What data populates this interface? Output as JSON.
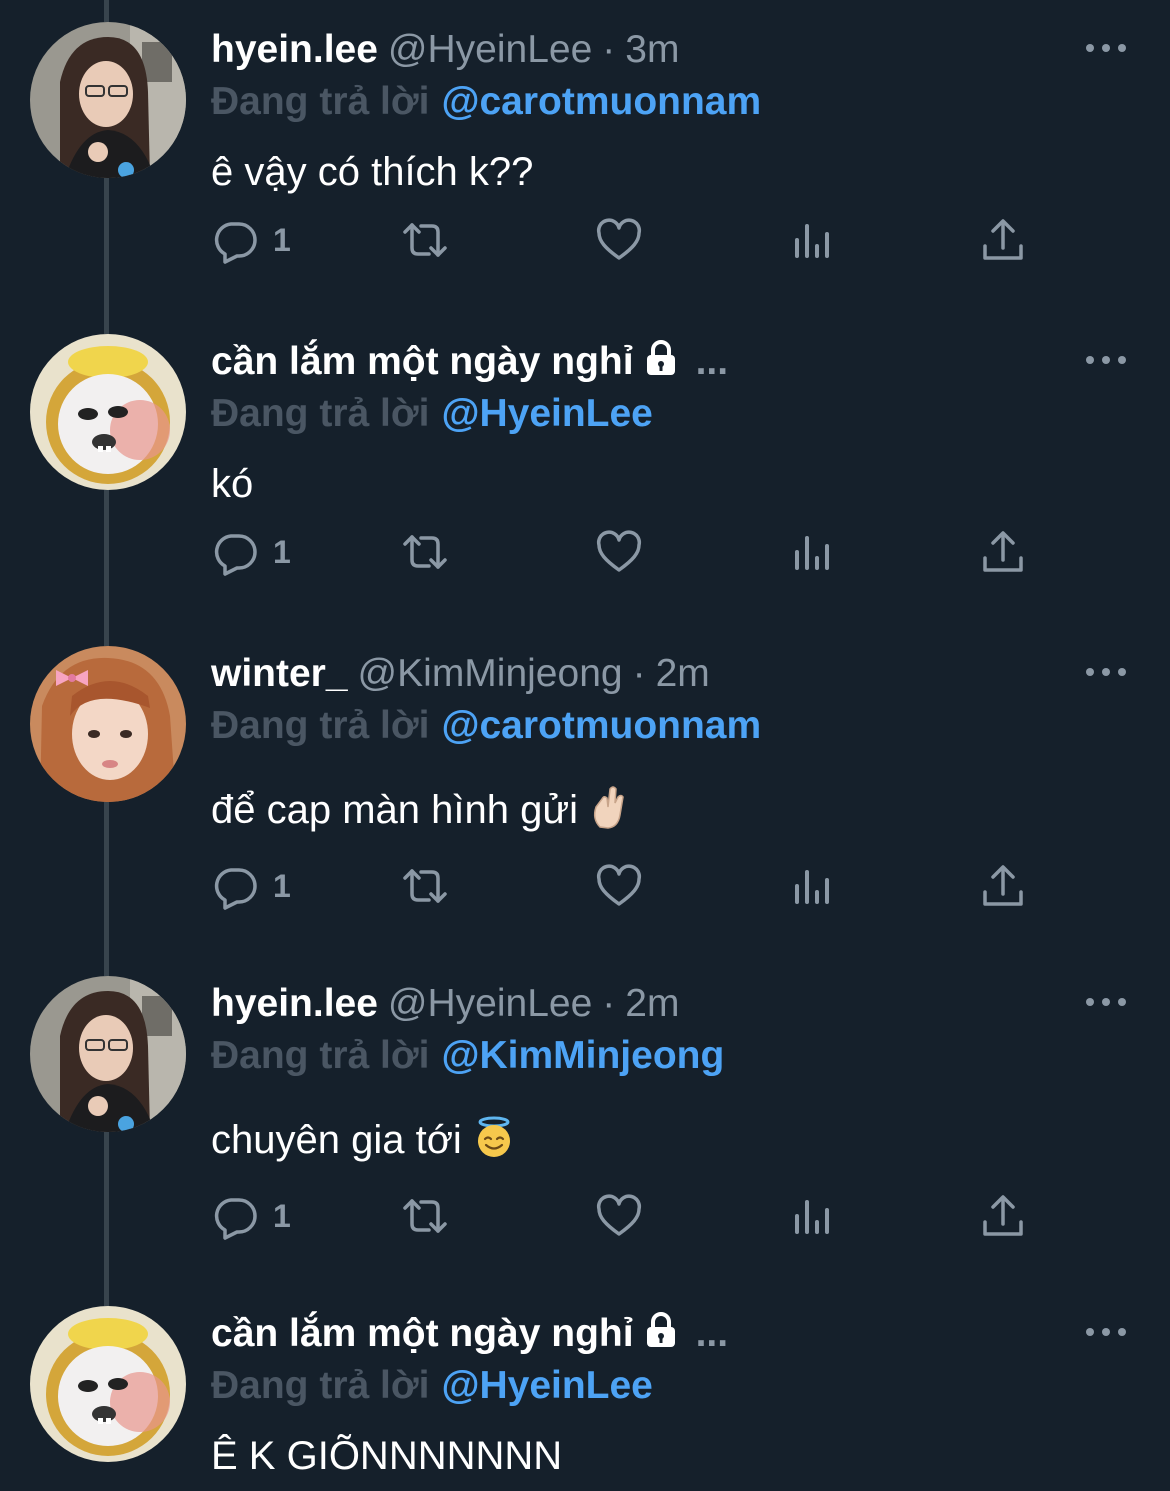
{
  "tweets": [
    {
      "name": "hyein.lee",
      "handle": "@HyeinLee",
      "dot": "·",
      "time": "3m",
      "locked": false,
      "reply_prefix": "Đang trả lời",
      "reply_to": "@carotmuonnam",
      "text": "ê vậy có thích k??",
      "reply_count": "1",
      "avatar": "girl-photo"
    },
    {
      "name": "cần lắm một ngày nghỉ",
      "truncation": "...",
      "locked": true,
      "reply_prefix": "Đang trả lời",
      "reply_to": "@HyeinLee",
      "text": "kó",
      "reply_count": "1",
      "avatar": "cartoon-character"
    },
    {
      "name": "winter_",
      "handle": "@KimMinjeong",
      "dot": "·",
      "time": "2m",
      "locked": false,
      "reply_prefix": "Đang trả lời",
      "reply_to": "@carotmuonnam",
      "text": "để cap màn hình gửi",
      "emoji": "crossed-fingers-emoji",
      "reply_count": "1",
      "avatar": "girl-with-bow"
    },
    {
      "name": "hyein.lee",
      "handle": "@HyeinLee",
      "dot": "·",
      "time": "2m",
      "locked": false,
      "reply_prefix": "Đang trả lời",
      "reply_to": "@KimMinjeong",
      "text": "chuyên gia tới",
      "emoji": "smiling-face-with-halo-emoji",
      "reply_count": "1",
      "avatar": "girl-photo"
    },
    {
      "name": "cần lắm một ngày nghỉ",
      "truncation": "...",
      "locked": true,
      "reply_prefix": "Đang trả lời",
      "reply_to": "@HyeinLee",
      "text": "Ê K GIÕNNNNNNN",
      "avatar": "cartoon-character"
    }
  ],
  "colors": {
    "background": "#15202b",
    "thread_line": "#38444d",
    "secondary_text": "#8b98a5",
    "reply_prefix": "#4a5663",
    "link": "#4da3f5"
  },
  "icons": [
    "reply-icon",
    "retweet-icon",
    "like-icon",
    "analytics-icon",
    "share-icon",
    "more-icon",
    "lock-icon"
  ]
}
